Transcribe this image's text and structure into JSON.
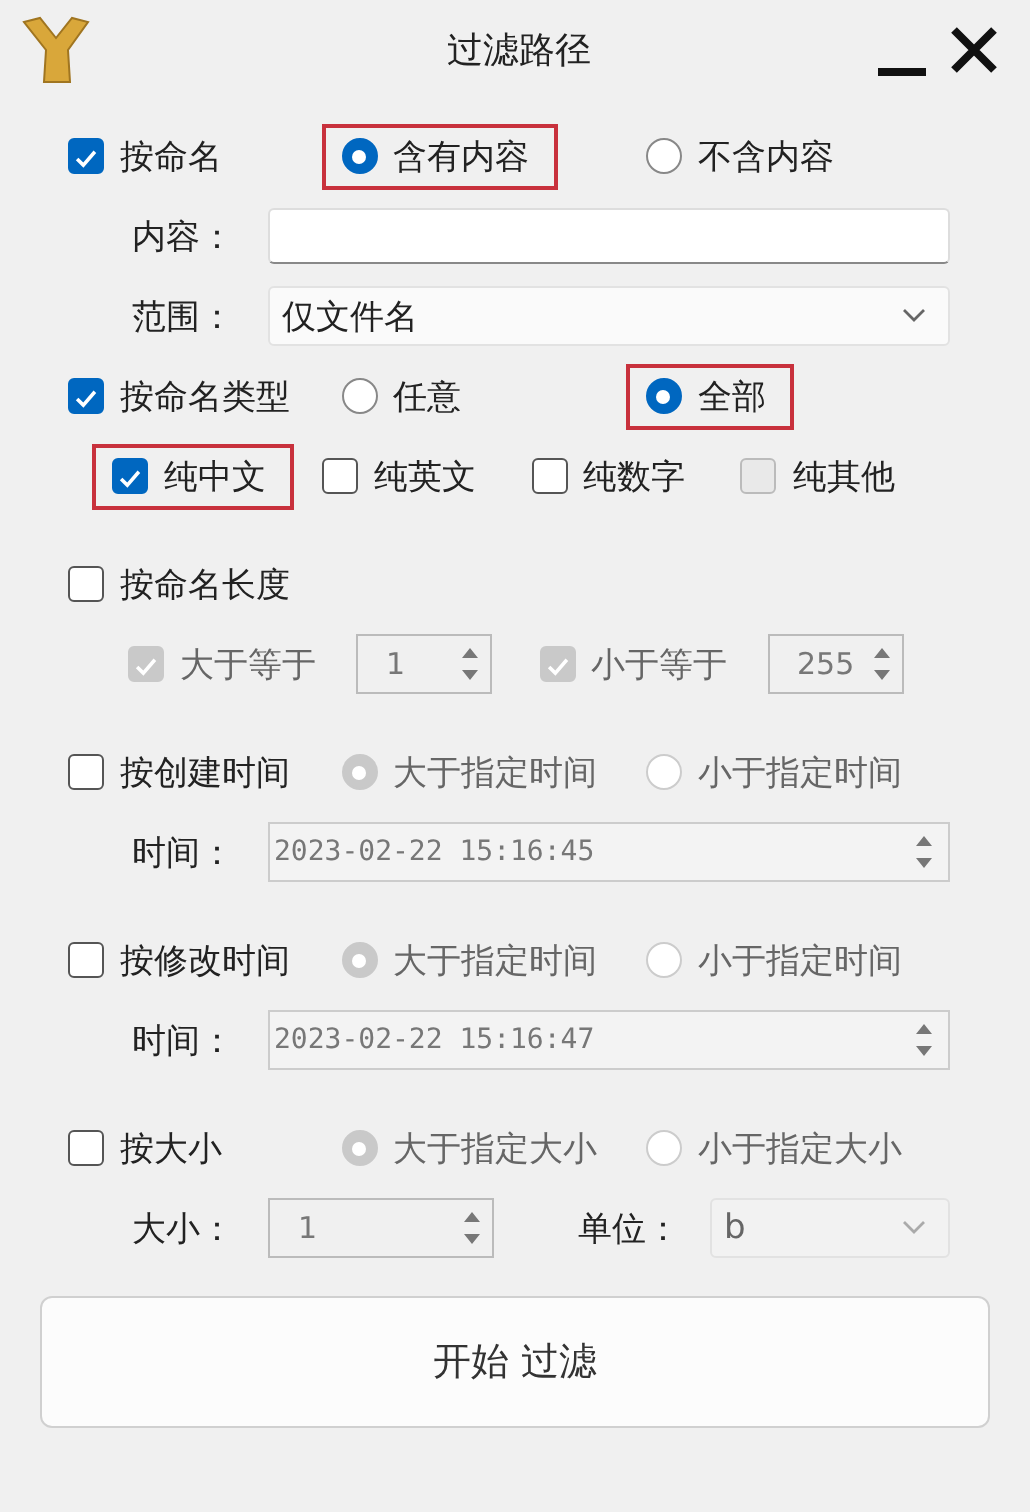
{
  "window": {
    "title": "过滤路径"
  },
  "name_filter": {
    "label": "按命名",
    "checked": true,
    "modes": [
      {
        "label": "含有内容",
        "selected": true,
        "highlighted": true
      },
      {
        "label": "不含内容",
        "selected": false,
        "highlighted": false
      }
    ],
    "content": {
      "label": "内容："
    },
    "scope": {
      "label": "范围：",
      "value": "仅文件名"
    }
  },
  "type_filter": {
    "label": "按命名类型",
    "checked": true,
    "modes": [
      {
        "label": "任意",
        "selected": false,
        "highlighted": false
      },
      {
        "label": "全部",
        "selected": true,
        "highlighted": true
      }
    ],
    "types": [
      {
        "label": "纯中文",
        "checked": true,
        "highlighted": true,
        "disabled": false
      },
      {
        "label": "纯英文",
        "checked": false,
        "highlighted": false,
        "disabled": false
      },
      {
        "label": "纯数字",
        "checked": false,
        "highlighted": false,
        "disabled": false
      },
      {
        "label": "纯其他",
        "checked": false,
        "highlighted": false,
        "disabled": true
      }
    ]
  },
  "length_filter": {
    "label": "按命名长度",
    "checked": false,
    "disabled": true,
    "bounds": [
      {
        "label": "大于等于",
        "checked": true,
        "value": "1"
      },
      {
        "label": "小于等于",
        "checked": true,
        "value": "255"
      }
    ]
  },
  "time_filters": [
    {
      "label": "按创建时间",
      "checked": false,
      "disabled": true,
      "modes": [
        {
          "label": "大于指定时间",
          "selected": true
        },
        {
          "label": "小于指定时间",
          "selected": false
        }
      ],
      "time_label": "时间：",
      "value": "2023-02-22 15:16:45"
    },
    {
      "label": "按修改时间",
      "checked": false,
      "disabled": true,
      "modes": [
        {
          "label": "大于指定时间",
          "selected": true
        },
        {
          "label": "小于指定时间",
          "selected": false
        }
      ],
      "time_label": "时间：",
      "value": "2023-02-22 15:16:47"
    }
  ],
  "size_filter": {
    "label": "按大小",
    "checked": false,
    "disabled": true,
    "modes": [
      {
        "label": "大于指定大小",
        "selected": true
      },
      {
        "label": "小于指定大小",
        "selected": false
      }
    ],
    "size_label": "大小：",
    "size_value": "1",
    "unit_label": "单位：",
    "unit_value": "b"
  },
  "start_button": {
    "label": "开始 过滤"
  }
}
